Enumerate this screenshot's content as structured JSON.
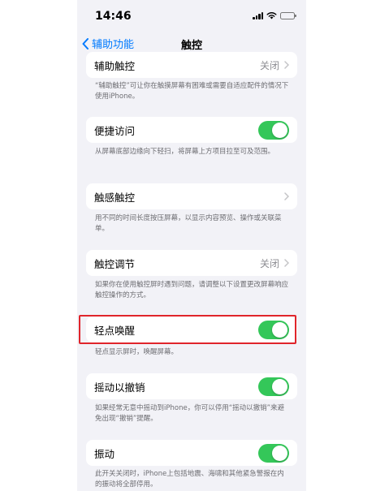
{
  "status": {
    "time": "14:46"
  },
  "nav": {
    "back_label": "辅助功能",
    "title": "触控"
  },
  "cells": [
    {
      "label": "辅助触控",
      "value": "关闭",
      "type": "disclosure"
    },
    {
      "label": "便捷访问",
      "type": "toggle",
      "on": true
    },
    {
      "label": "触感触控",
      "type": "disclosure"
    },
    {
      "label": "触控调节",
      "value": "关闭",
      "type": "disclosure"
    },
    {
      "label": "轻点唤醒",
      "type": "toggle",
      "on": true
    },
    {
      "label": "摇动以撤销",
      "type": "toggle",
      "on": true
    },
    {
      "label": "振动",
      "type": "toggle",
      "on": true
    }
  ],
  "footers": [
    "“辅助触控”可让你在触摸屏幕有困难或需要自适应配件的情况下使用iPhone。",
    "从屏幕底部边缘向下轻扫，将屏幕上方项目拉至可及范围。",
    "用不同的时间长度按压屏幕，以显示内容预览、操作或关联菜单。",
    "如果你在使用触控屏时遇到问题，请调整以下设置更改屏幕响应触控操作的方式。",
    "轻点显示屏时，唤醒屏幕。",
    "如果经常无意中摇动到iPhone，你可以停用“摇动以撤销”来避免出现“撤销”提醒。",
    "此开关关闭时，iPhone上包括地震、海啸和其他紧急警报在内的振动将全部停用。"
  ],
  "colors": {
    "accent": "#007aff",
    "toggle_on": "#34c759",
    "highlight": "#e0252b",
    "background": "#f2f2f7"
  }
}
